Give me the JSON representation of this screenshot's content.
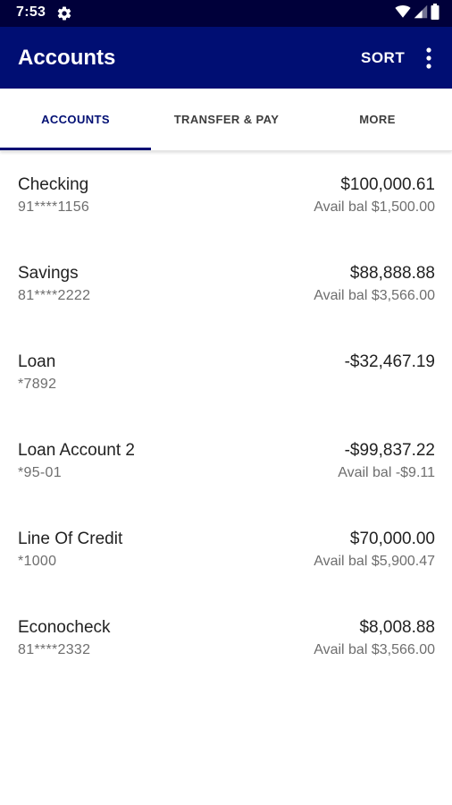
{
  "status_bar": {
    "time": "7:53",
    "icons": [
      "gear-icon",
      "wifi-icon",
      "cellular-icon",
      "battery-icon"
    ]
  },
  "app_bar": {
    "title": "Accounts",
    "sort_label": "SORT",
    "overflow_icon": "more-vert-icon"
  },
  "tabs": [
    {
      "label": "ACCOUNTS",
      "active": true
    },
    {
      "label": "TRANSFER & PAY",
      "active": false
    },
    {
      "label": "MORE",
      "active": false
    }
  ],
  "accounts": [
    {
      "name": "Checking",
      "number": "91****1156",
      "balance": "$100,000.61",
      "available": "Avail bal $1,500.00"
    },
    {
      "name": "Savings",
      "number": "81****2222",
      "balance": "$88,888.88",
      "available": "Avail bal $3,566.00"
    },
    {
      "name": "Loan",
      "number": "*7892",
      "balance": "-$32,467.19",
      "available": ""
    },
    {
      "name": "Loan Account 2",
      "number": "*95-01",
      "balance": "-$99,837.22",
      "available": "Avail bal -$9.11"
    },
    {
      "name": "Line Of Credit",
      "number": "*1000",
      "balance": "$70,000.00",
      "available": "Avail bal $5,900.47"
    },
    {
      "name": "Econocheck",
      "number": "81****2332",
      "balance": "$8,008.88",
      "available": "Avail bal $3,566.00"
    }
  ],
  "colors": {
    "status_bar": "#00003a",
    "app_bar": "#000e73",
    "accent": "#000e73",
    "text_primary": "#222222",
    "text_secondary": "#6e6e6e"
  }
}
